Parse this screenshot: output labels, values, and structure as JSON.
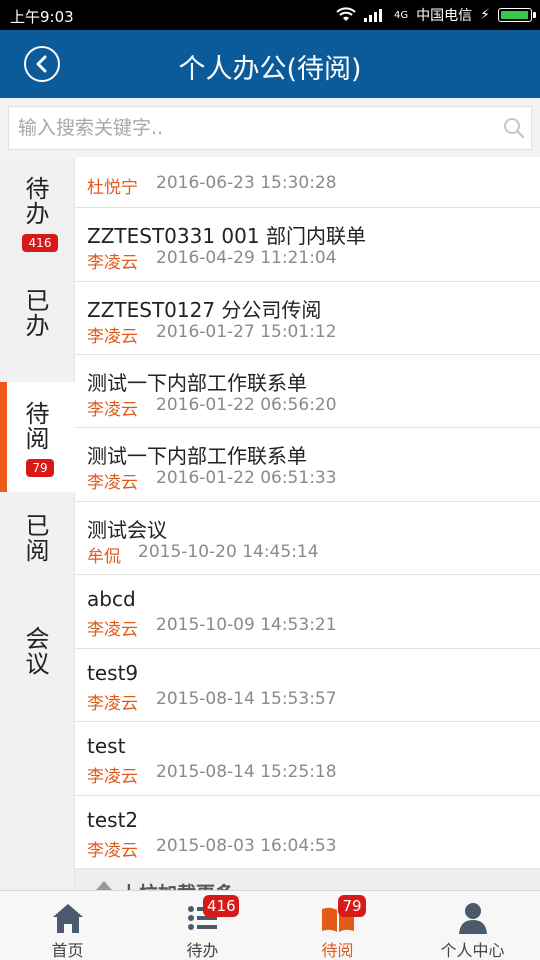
{
  "status_bar": {
    "time": "上午9:03",
    "network": "4G",
    "carrier": "中国电信",
    "battery_level": 0.95
  },
  "header": {
    "title": "个人办公(待阅)",
    "back_icon": "chevron-left-icon"
  },
  "search": {
    "placeholder": "输入搜索关键字..",
    "value": ""
  },
  "sidebar": {
    "tabs": [
      {
        "label": [
          "待",
          "办"
        ],
        "badge": "416",
        "active": false
      },
      {
        "label": [
          "已",
          "办"
        ],
        "badge": "",
        "active": false
      },
      {
        "label": [
          "待",
          "阅"
        ],
        "badge": "79",
        "active": true
      },
      {
        "label": [
          "已",
          "阅"
        ],
        "badge": "",
        "active": false
      },
      {
        "label": [
          "会",
          "议"
        ],
        "badge": "",
        "active": false
      }
    ]
  },
  "list": {
    "items": [
      {
        "title": "",
        "sender": "杜悦宁",
        "time": "2016-06-23 15:30:28"
      },
      {
        "title": "ZZTEST0331 001 部门内联单",
        "sender": "李凌云",
        "time": "2016-04-29 11:21:04"
      },
      {
        "title": "ZZTEST0127 分公司传阅",
        "sender": "李凌云",
        "time": "2016-01-27 15:01:12"
      },
      {
        "title": "测试一下内部工作联系单",
        "sender": "李凌云",
        "time": "2016-01-22 06:56:20"
      },
      {
        "title": "测试一下内部工作联系单",
        "sender": "李凌云",
        "time": "2016-01-22 06:51:33"
      },
      {
        "title": "测试会议",
        "sender": "牟侃",
        "time": "2015-10-20 14:45:14"
      },
      {
        "title": "abcd",
        "sender": "李凌云",
        "time": "2015-10-09 14:53:21"
      },
      {
        "title": "test9",
        "sender": "李凌云",
        "time": "2015-08-14 15:53:57"
      },
      {
        "title": "test",
        "sender": "李凌云",
        "time": "2015-08-14 15:25:18"
      },
      {
        "title": "test2",
        "sender": "李凌云",
        "time": "2015-08-03 16:04:53"
      }
    ],
    "load_more": "上拉加载更多"
  },
  "tabbar": {
    "tabs": [
      {
        "label": "首页",
        "icon": "home-icon",
        "badge": ""
      },
      {
        "label": "待办",
        "icon": "list-icon",
        "badge": "416"
      },
      {
        "label": "待阅",
        "icon": "book-icon",
        "badge": "79",
        "active": true
      },
      {
        "label": "个人中心",
        "icon": "person-icon",
        "badge": ""
      }
    ]
  },
  "colors": {
    "header_bg": "#0b5a9a",
    "accent": "#e45b18",
    "badge": "#d71a17"
  }
}
